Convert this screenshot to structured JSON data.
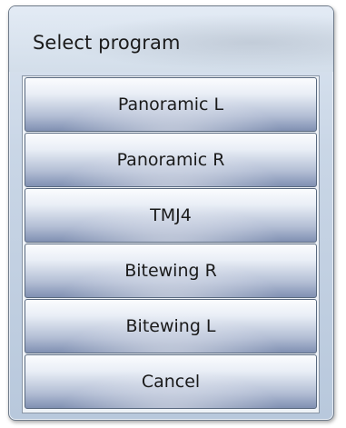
{
  "dialog": {
    "title": "Select program"
  },
  "programs": [
    {
      "label": "Panoramic L"
    },
    {
      "label": "Panoramic R"
    },
    {
      "label": "TMJ4"
    },
    {
      "label": "Bitewing R"
    },
    {
      "label": "Bitewing L"
    }
  ],
  "cancel": {
    "label": "Cancel"
  },
  "colors": {
    "button_top": "#fbfcfe",
    "button_bottom": "#8090b2",
    "border": "#59697f"
  }
}
